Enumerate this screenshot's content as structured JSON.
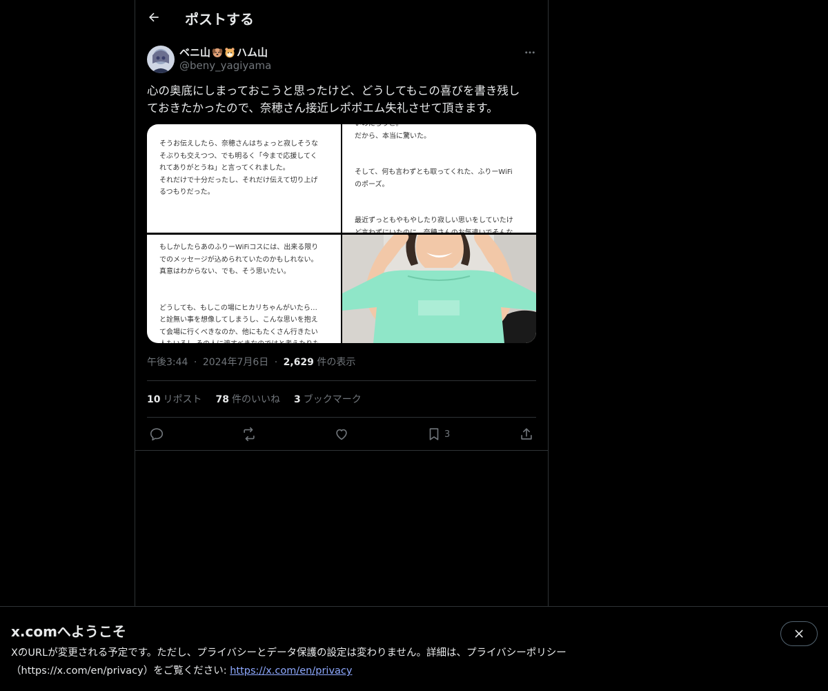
{
  "header": {
    "title": "ポストする",
    "back_icon": "arrow-left-icon"
  },
  "post": {
    "display_name": "ベニ山",
    "display_name_suffix": "ハム山",
    "emojis": [
      "dog-face-emoji",
      "hamster-face-emoji"
    ],
    "handle": "@beny_yagiyama",
    "text": "心の奥底にしまっておこうと思ったけど、どうしてもこの喜びを書き残し\nておきたかったので、奈穂さん接近レポポエム失礼させて頂きます。",
    "images": {
      "top_left": "そうお伝えしたら、奈穂さんはちょっと寂しそうな\nそぶりも交えつつ、でも明るく「今まで応援してく\nれてありがとうね」と言ってくれました。\nそれだけで十分だったし、それだけ伝えて切り上げ\nるつもりだった。",
      "top_right": "いのだろうと。\nだから、本当に驚いた。\n\n\nそして、何も言わずとも取ってくれた、ふりーWiFi\nのポーズ。\n\n\n最近ずっともやもやしたり寂しい思いをしていたけ\nど言わずにいたのに、奈穂さんのお気遣いでそんな",
      "bottom_left": "もしかしたらあのふりーWiFiコスには、出来る限り\nでのメッセージが込められていたのかもしれない。\n真意はわからない、でも、そう思いたい。\n\n\nどうしても、もしこの場にヒカリちゃんがいたら…\nと詮無い事を想像してしまうし、こんな思いを抱え\nて会場に行くべきなのか、他にもたくさん行きたい\n人もいるし その人に渡すべきなのではと考えたりも",
      "bottom_right_alt": "photo"
    },
    "time": "午後3:44",
    "date": "2024年7月6日",
    "views_count": "2,629",
    "views_label": "件の表示",
    "separator": "·"
  },
  "stats": {
    "reposts_count": "10",
    "reposts_label": "リポスト",
    "likes_count": "78",
    "likes_label": "件のいいね",
    "bookmarks_count": "3",
    "bookmarks_label": "ブックマーク"
  },
  "actions": {
    "bookmark_count": "3"
  },
  "banner": {
    "title": "x.comへようこそ",
    "body": "XのURLが変更される予定です。ただし、プライバシーとデータ保護の設定は変わりません。詳細は、プライバシーポリシー（https://x.com/en/privacy）をご覧ください: ",
    "link_text": "https://x.com/en/privacy"
  },
  "colors": {
    "background": "#000000",
    "text": "#e7e9ea",
    "muted": "#71767b",
    "border": "#2f3336",
    "link": "#8ea9ff",
    "shirt": "#8fe6c8"
  }
}
